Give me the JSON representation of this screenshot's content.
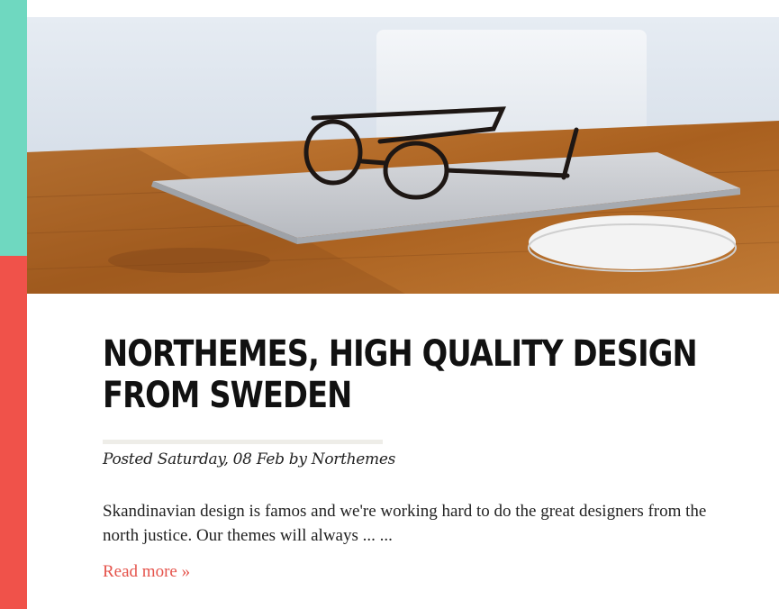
{
  "post": {
    "title": "NORTHEMES, HIGH QUALITY DESIGN FROM SWEDEN",
    "meta": "Posted Saturday, 08 Feb by Northemes",
    "excerpt": "Skandinavian design is famos and we're working hard to do the great designers from the north justice. Our themes will always ... ...",
    "read_more": "Read more »"
  },
  "colors": {
    "accent_teal": "#6fd8c0",
    "accent_red": "#f0524a",
    "link": "#e5534b"
  },
  "hero_image": {
    "subject": "laptop-glasses-mouse-photo"
  }
}
